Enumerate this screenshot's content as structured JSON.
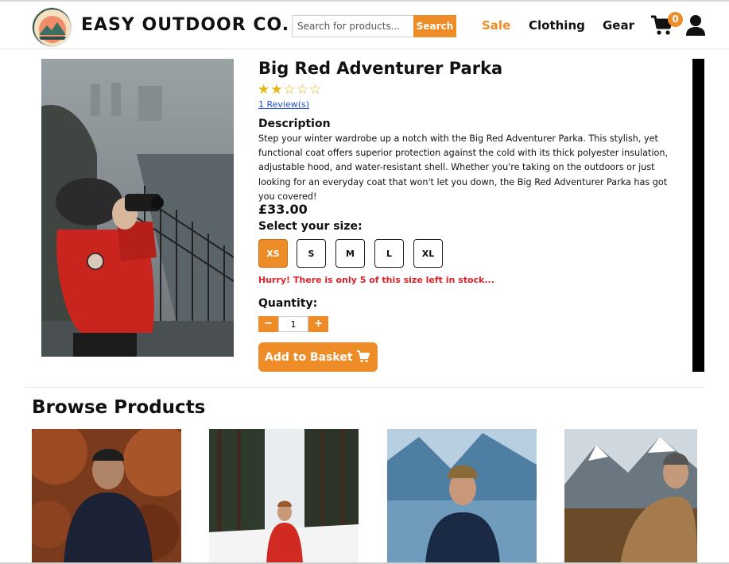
{
  "header": {
    "logo_text": "EASY OUTDOOR",
    "brand": "EASY OUTDOOR CO.",
    "search_placeholder": "Search for products...",
    "search_button": "Search",
    "nav": {
      "sale": "Sale",
      "clothing": "Clothing",
      "gear": "Gear"
    },
    "cart_count": "0"
  },
  "product": {
    "title": "Big Red Adventurer Parka",
    "rating": "2 of 5",
    "stars": "★★☆☆☆",
    "reviews_link": "1 Review(s)",
    "description_heading": "Description",
    "description": "Step your winter wardrobe up a notch with the Big Red Adventurer Parka. This stylish, yet functional coat offers superior protection against the cold with its thick polyester insulation, adjustable hood, and water-resistant shell. Whether you're taking on the outdoors or just looking for an everyday coat that won't let you down, the Big Red Adventurer Parka has got you covered!",
    "price": "£33.00",
    "size_heading": "Select your size:",
    "sizes": [
      "XS",
      "S",
      "M",
      "L",
      "XL"
    ],
    "selected_size": "XS",
    "stock_warning": "Hurry! There is only 5 of this size left in stock...",
    "quantity_heading": "Quantity:",
    "quantity_value": "1",
    "qty_minus": "−",
    "qty_plus": "+",
    "add_to_basket": "Add to Basket"
  },
  "browse": {
    "heading": "Browse Products"
  },
  "colors": {
    "accent": "#ee8c27",
    "warning": "#d8232a",
    "star": "#e5b712",
    "link": "#1a4fd6"
  },
  "icons": {
    "cart": "cart-icon",
    "user": "user-icon",
    "logo": "logo-icon"
  }
}
